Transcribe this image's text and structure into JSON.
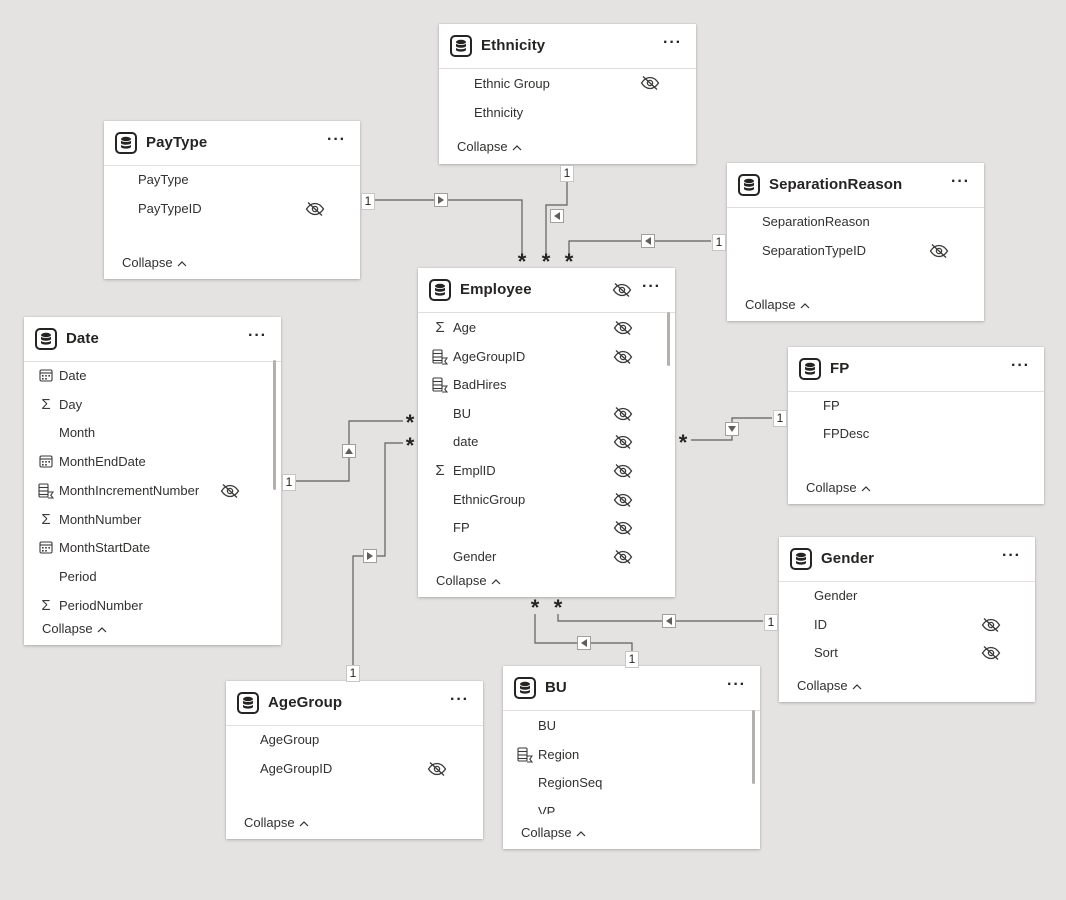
{
  "colors": {
    "canvas": "#e4e3e2",
    "card": "#ffffff",
    "line": "#605e5c",
    "text": "#252423",
    "collapse_text": "#323130"
  },
  "cards": {
    "ethnicity": {
      "title": "Ethnicity",
      "fields": [
        {
          "name": "Ethnic Group",
          "icon": "none",
          "hidden": true
        },
        {
          "name": "Ethnicity",
          "icon": "none",
          "hidden": false
        }
      ],
      "collapse": "Collapse"
    },
    "paytype": {
      "title": "PayType",
      "fields": [
        {
          "name": "PayType",
          "icon": "none",
          "hidden": false
        },
        {
          "name": "PayTypeID",
          "icon": "none",
          "hidden": true
        }
      ],
      "collapse": "Collapse"
    },
    "separationreason": {
      "title": "SeparationReason",
      "fields": [
        {
          "name": "SeparationReason",
          "icon": "none",
          "hidden": false
        },
        {
          "name": "SeparationTypeID",
          "icon": "none",
          "hidden": true
        }
      ],
      "collapse": "Collapse"
    },
    "employee": {
      "title": "Employee",
      "header_hidden": true,
      "fields": [
        {
          "name": "Age",
          "icon": "sigma",
          "hidden": true
        },
        {
          "name": "AgeGroupID",
          "icon": "calc-column",
          "hidden": true
        },
        {
          "name": "BadHires",
          "icon": "calc-column",
          "hidden": false
        },
        {
          "name": "BU",
          "icon": "none",
          "hidden": true
        },
        {
          "name": "date",
          "icon": "none",
          "hidden": true
        },
        {
          "name": "EmplID",
          "icon": "sigma",
          "hidden": true
        },
        {
          "name": "EthnicGroup",
          "icon": "none",
          "hidden": true
        },
        {
          "name": "FP",
          "icon": "none",
          "hidden": true
        },
        {
          "name": "Gender",
          "icon": "none",
          "hidden": true
        }
      ],
      "collapse": "Collapse"
    },
    "date": {
      "title": "Date",
      "fields": [
        {
          "name": "Date",
          "icon": "calendar",
          "hidden": false
        },
        {
          "name": "Day",
          "icon": "sigma",
          "hidden": false
        },
        {
          "name": "Month",
          "icon": "none",
          "hidden": false
        },
        {
          "name": "MonthEndDate",
          "icon": "calendar",
          "hidden": false
        },
        {
          "name": "MonthIncrementNumber",
          "icon": "calc-column",
          "hidden": true
        },
        {
          "name": "MonthNumber",
          "icon": "sigma",
          "hidden": false
        },
        {
          "name": "MonthStartDate",
          "icon": "calendar",
          "hidden": false
        },
        {
          "name": "Period",
          "icon": "none",
          "hidden": false
        },
        {
          "name": "PeriodNumber",
          "icon": "sigma",
          "hidden": false
        }
      ],
      "collapse": "Collapse"
    },
    "fp": {
      "title": "FP",
      "fields": [
        {
          "name": "FP",
          "icon": "none",
          "hidden": false
        },
        {
          "name": "FPDesc",
          "icon": "none",
          "hidden": false
        }
      ],
      "collapse": "Collapse"
    },
    "gender": {
      "title": "Gender",
      "fields": [
        {
          "name": "Gender",
          "icon": "none",
          "hidden": false
        },
        {
          "name": "ID",
          "icon": "none",
          "hidden": true
        },
        {
          "name": "Sort",
          "icon": "none",
          "hidden": true
        }
      ],
      "collapse": "Collapse"
    },
    "agegroup": {
      "title": "AgeGroup",
      "fields": [
        {
          "name": "AgeGroup",
          "icon": "none",
          "hidden": false
        },
        {
          "name": "AgeGroupID",
          "icon": "none",
          "hidden": true
        }
      ],
      "collapse": "Collapse"
    },
    "bu": {
      "title": "BU",
      "fields": [
        {
          "name": "BU",
          "icon": "none",
          "hidden": false
        },
        {
          "name": "Region",
          "icon": "calc-column",
          "hidden": false
        },
        {
          "name": "RegionSeq",
          "icon": "none",
          "hidden": false
        },
        {
          "name": "VP",
          "icon": "none",
          "hidden": false
        }
      ],
      "collapse": "Collapse"
    }
  },
  "relationships": [
    {
      "from": "PayType",
      "to": "Employee",
      "from_cardinality": "1",
      "to_cardinality": "*",
      "direction": "single"
    },
    {
      "from": "Ethnicity",
      "to": "Employee",
      "from_cardinality": "1",
      "to_cardinality": "*",
      "direction": "single"
    },
    {
      "from": "SeparationReason",
      "to": "Employee",
      "from_cardinality": "1",
      "to_cardinality": "*",
      "direction": "single"
    },
    {
      "from": "Date",
      "to": "Employee",
      "from_cardinality": "1",
      "to_cardinality": "*",
      "direction": "single"
    },
    {
      "from": "AgeGroup",
      "to": "Employee",
      "from_cardinality": "1",
      "to_cardinality": "*",
      "direction": "single"
    },
    {
      "from": "FP",
      "to": "Employee",
      "from_cardinality": "1",
      "to_cardinality": "*",
      "direction": "single"
    },
    {
      "from": "Gender",
      "to": "Employee",
      "from_cardinality": "1",
      "to_cardinality": "*",
      "direction": "single"
    },
    {
      "from": "BU",
      "to": "Employee",
      "from_cardinality": "1",
      "to_cardinality": "*",
      "direction": "single"
    }
  ],
  "labels": {
    "one": "1",
    "many": "*",
    "ellipsis": "···",
    "chevron": "^"
  }
}
